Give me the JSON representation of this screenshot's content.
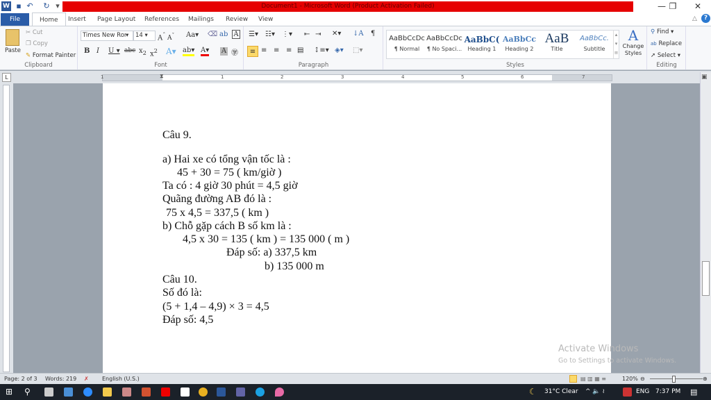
{
  "window": {
    "title": "Document1  -  Microsoft Word (Product Activation Failed)",
    "controls": [
      "minimize",
      "restore",
      "close"
    ]
  },
  "tabs": [
    "File",
    "Home",
    "Insert",
    "Page Layout",
    "References",
    "Mailings",
    "Review",
    "View"
  ],
  "clipboard": {
    "paste": "Paste",
    "cut": "Cut",
    "copy": "Copy",
    "format_painter": "Format Painter",
    "label": "Clipboard"
  },
  "font": {
    "name": "Times New Roman",
    "size": "14",
    "label": "Font"
  },
  "paragraph": {
    "label": "Paragraph"
  },
  "styles": {
    "items": [
      {
        "preview": "AaBbCcDc",
        "name": "¶ Normal"
      },
      {
        "preview": "AaBbCcDc",
        "name": "¶ No Spaci..."
      },
      {
        "preview": "AaBbC(",
        "name": "Heading 1"
      },
      {
        "preview": "AaBbCc",
        "name": "Heading 2"
      },
      {
        "preview": "AaB",
        "name": "Title"
      },
      {
        "preview": "AaBbCc.",
        "name": "Subtitle"
      }
    ],
    "change_styles": "Change Styles",
    "label": "Styles"
  },
  "editing": {
    "find": "Find",
    "replace": "Replace",
    "select": "Select",
    "label": "Editing"
  },
  "ruler": {
    "numbers": [
      "1",
      "1",
      "2",
      "3",
      "4",
      "5",
      "6",
      "7"
    ]
  },
  "document": {
    "lines": [
      "Câu 9.",
      "a) Hai xe có tổng vận tốc là :",
      "45 + 30 = 75 ( km/giờ )",
      "Ta có : 4 giờ 30 phút = 4,5 giờ",
      "Quãng đường AB đó là :",
      "75 x 4,5 = 337,5 ( km )",
      "b) Chỗ gặp cách B số km là :",
      "4,5 x 30 = 135 ( km ) = 135 000 ( m )",
      "Đáp số: a) 337,5 km",
      "b) 135 000 m",
      "Câu 10.",
      "Số đó là:",
      "(5 + 1,4 – 4,9) × 3 = 4,5",
      "Đáp số: 4,5"
    ]
  },
  "watermark": {
    "title": "Activate Windows",
    "subtitle": "Go to Settings to activate Windows."
  },
  "status": {
    "page": "Page: 2 of 3",
    "words": "Words: 219",
    "language": "English (U.S.)",
    "zoom": "120%",
    "zoom_level_percent": 120
  },
  "taskbar": {
    "weather": "31°C  Clear",
    "lang": "ENG",
    "time": "7:37 PM"
  },
  "colors": {
    "title_bar_red": "#e60000",
    "file_tab": "#2a5ca8",
    "taskbar": "#1b2129"
  }
}
